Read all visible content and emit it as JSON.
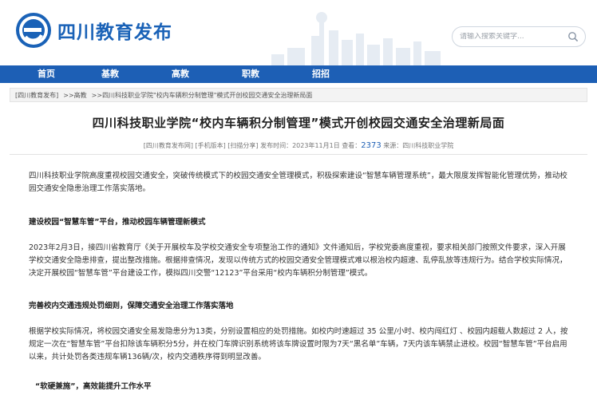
{
  "site": {
    "logo_text": "四川教育发布"
  },
  "search": {
    "placeholder": "请输入搜索关键字..."
  },
  "nav": {
    "items": [
      "首页",
      "基教",
      "高教",
      "职教",
      "招招"
    ]
  },
  "breadcrumb": {
    "items": [
      "[四川教育发布]",
      ">>高教",
      ">>四川科技职业学院\"校内车辆积分制管理\"模式开创校园交通安全治理新局面"
    ]
  },
  "article": {
    "title": "四川科技职业学院“校内车辆积分制管理”模式开创校园交通安全治理新局面",
    "meta": {
      "site": "[四川教育发布网]",
      "mobile": "[手机版本]",
      "share": "[扫描分享]",
      "date": "发布时间：2023年11月1日",
      "hits_label": "查看：",
      "hits": "2373",
      "source": "来源：四川科技职业学院"
    },
    "p1": "四川科技职业学院高度重视校园交通安全，突破传统模式下的校园交通安全管理模式，积极探索建设“智慧车辆管理系统”，最大限度发挥智能化管理优势，推动校园交通安全隐患治理工作落实落地。",
    "h1": "建设校园“智慧车管”平台，推动校园车辆管理新模式",
    "p2": "2023年2月3日，接四川省教育厅《关于开展校车及学校交通安全专项整治工作的通知》文件通知后，学校党委高度重视，要求相关部门按照文件要求，深入开展学校交通安全隐患排查，提出整改措施。根据排查情况，发现以传统方式的校园交通安全管理模式难以根治校内超速、乱停乱放等违规行为。结合学校实际情况，决定开展校园“智慧车管”平台建设工作，模拟四川交警“12123”平台采用“校内车辆积分制管理”模式。",
    "h2": "完善校内交通违规处罚细则，保障交通安全治理工作落实落地",
    "p3": "根据学校实际情况，将校园交通安全易发隐患分为13类，分别设置相应的处罚措施。如校内时速超过 35 公里/小时、校内闯红灯 、校园内超载人数超过 2 人，按规定一次在“智慧车管”平台扣除该车辆积分5分，并在校门车牌识别系统将该车牌设置时限为7天“黑名单”车辆，7天内该车辆禁止进校。校园“智慧车管”平台启用以来，共计处罚各类违规车辆136辆/次，校内交通秩序得到明显改善。",
    "h3": "“软硬兼施”，高效能提升工作水平"
  }
}
